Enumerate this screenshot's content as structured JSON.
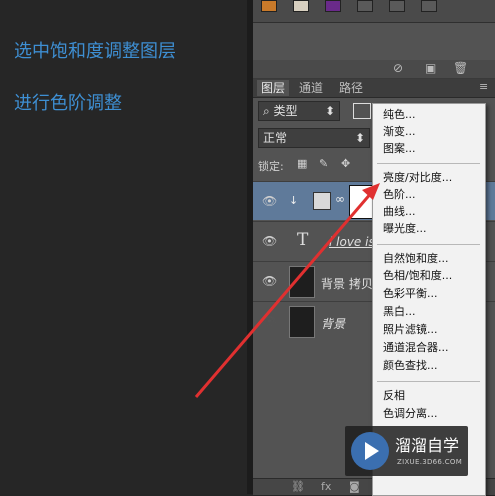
{
  "annotations": {
    "line1": "选中饱和度调整图层",
    "line2": "进行色阶调整"
  },
  "layers_panel": {
    "tabs": [
      "图层",
      "通道",
      "路径"
    ],
    "filter_label": "类型",
    "blend_mode": "正常",
    "lock_label": "锁定:",
    "layers": [
      {
        "name": "",
        "type": "adjustment"
      },
      {
        "name": "i love is",
        "type": "text"
      },
      {
        "name": "背景 拷贝",
        "type": "image"
      },
      {
        "name": "背景",
        "type": "image"
      }
    ],
    "bottom_icons": [
      "link-icon",
      "fx-icon",
      "mask-icon",
      "adjustment-icon",
      "folder-icon",
      "new-layer-icon",
      "trash-icon"
    ]
  },
  "adjustment_menu": {
    "groups": [
      [
        "纯色...",
        "渐变...",
        "图案..."
      ],
      [
        "亮度/对比度...",
        "色阶...",
        "曲线...",
        "曝光度..."
      ],
      [
        "自然饱和度...",
        "色相/饱和度...",
        "色彩平衡...",
        "黑白...",
        "照片滤镜...",
        "通道混合器...",
        "颜色查找..."
      ],
      [
        "反相",
        "色调分离..."
      ]
    ]
  },
  "watermark": {
    "title": "溜溜自学",
    "url": "ZIXUE.3D66.COM"
  },
  "colors": {
    "annotation_text": "#3e8fd3",
    "arrow": "#e03030",
    "panel_bg": "#535353",
    "menu_bg": "#f2f2f2"
  }
}
